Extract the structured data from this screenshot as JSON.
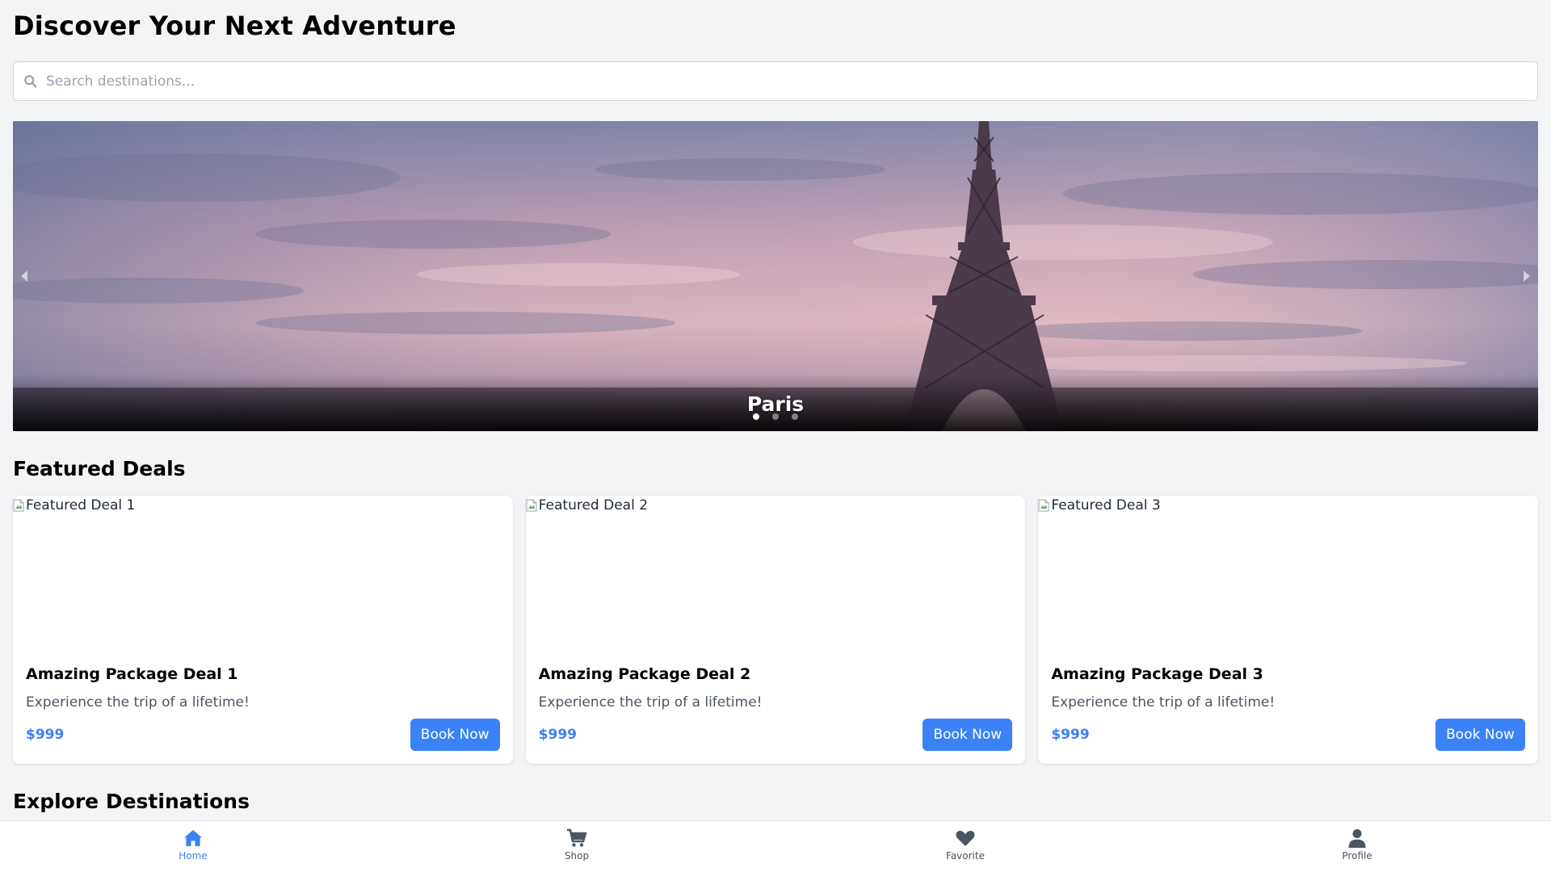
{
  "header": {
    "title": "Discover Your Next Adventure"
  },
  "search": {
    "placeholder": "Search destinations...",
    "value": ""
  },
  "carousel": {
    "caption": "Paris",
    "slide_count": 3,
    "active_index": 0
  },
  "featured": {
    "title": "Featured Deals",
    "deals": [
      {
        "image_alt": "Featured Deal 1",
        "title": "Amazing Package Deal 1",
        "description": "Experience the trip of a lifetime!",
        "price": "$999",
        "button_label": "Book Now"
      },
      {
        "image_alt": "Featured Deal 2",
        "title": "Amazing Package Deal 2",
        "description": "Experience the trip of a lifetime!",
        "price": "$999",
        "button_label": "Book Now"
      },
      {
        "image_alt": "Featured Deal 3",
        "title": "Amazing Package Deal 3",
        "description": "Experience the trip of a lifetime!",
        "price": "$999",
        "button_label": "Book Now"
      }
    ]
  },
  "explore": {
    "title": "Explore Destinations"
  },
  "nav": {
    "items": [
      {
        "label": "Home",
        "icon": "home-icon",
        "active": true
      },
      {
        "label": "Shop",
        "icon": "cart-icon",
        "active": false
      },
      {
        "label": "Favorite",
        "icon": "heart-icon",
        "active": false
      },
      {
        "label": "Profile",
        "icon": "user-icon",
        "active": false
      }
    ]
  },
  "colors": {
    "accent": "#3b82f6",
    "background": "#f3f4f6",
    "nav_inactive": "#4b5563"
  }
}
